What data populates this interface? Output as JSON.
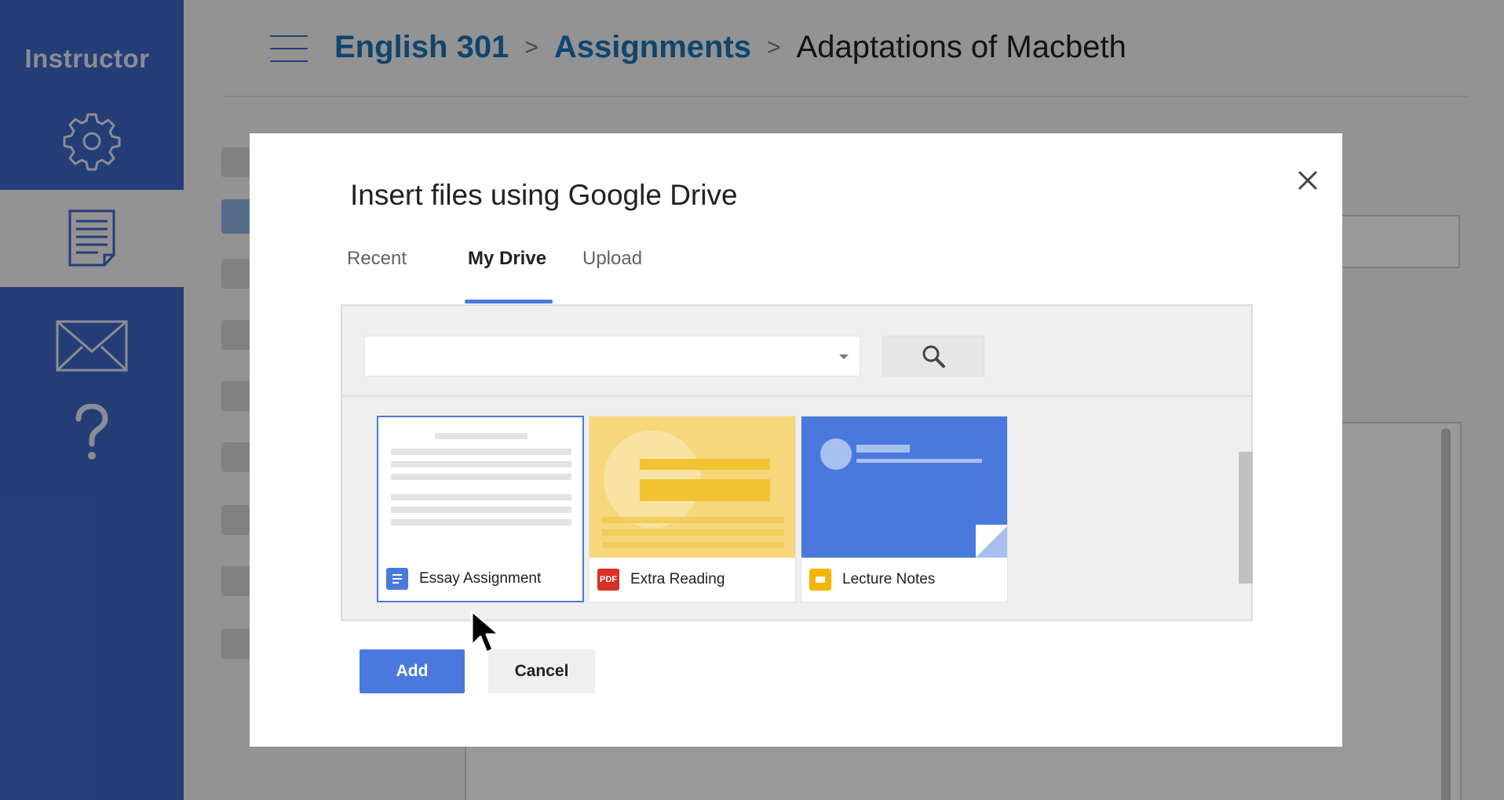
{
  "sidebar": {
    "title": "Instructor",
    "items": [
      {
        "icon": "gear-icon",
        "active": false
      },
      {
        "icon": "document-icon",
        "active": true
      },
      {
        "icon": "mail-icon",
        "active": false
      },
      {
        "icon": "help-icon",
        "active": false
      }
    ]
  },
  "header": {
    "breadcrumb": [
      "English 301",
      "Assignments",
      "Adaptations of Macbeth"
    ],
    "separator": ">"
  },
  "dialog": {
    "title": "Insert files using Google Drive",
    "tabs": [
      {
        "label": "Recent",
        "active": false
      },
      {
        "label": "My Drive",
        "active": true
      },
      {
        "label": "Upload",
        "active": false
      }
    ],
    "folder_select_value": "",
    "files": [
      {
        "name": "Essay Assignment",
        "type": "docs",
        "selected": true
      },
      {
        "name": "Extra Reading",
        "type": "pdf",
        "badge": "PDF",
        "selected": false
      },
      {
        "name": "Lecture Notes",
        "type": "slides",
        "selected": false
      }
    ],
    "add_label": "Add",
    "cancel_label": "Cancel"
  },
  "colors": {
    "sidebar": "#3f67c6",
    "accent": "#4a79dd",
    "link": "#1a73b8",
    "pdf": "#d93025",
    "slides": "#f4b400",
    "docs": "#4a79dd"
  }
}
